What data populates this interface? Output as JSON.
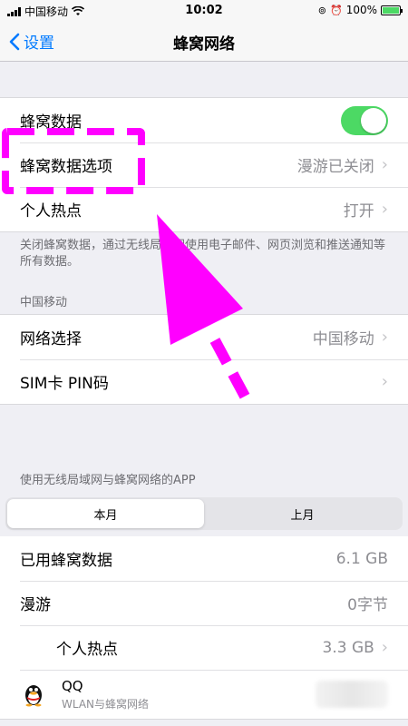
{
  "status_bar": {
    "carrier": "中国移动",
    "time": "10:02",
    "battery_percent": "100%",
    "battery_level": 1.0
  },
  "nav": {
    "back_label": "设置",
    "title": "蜂窝网络"
  },
  "cellular_group": {
    "cellular_data": {
      "label": "蜂窝数据",
      "enabled": true
    },
    "cellular_data_options": {
      "label": "蜂窝数据选项",
      "value": "漫游已关闭"
    },
    "personal_hotspot": {
      "label": "个人热点",
      "value": "打开"
    }
  },
  "cellular_footnote": "关闭蜂窝数据，通过无线局域网使用电子邮件、网页浏览和推送通知等所有数据。",
  "carrier_header": "中国移动",
  "carrier_group": {
    "network_selection": {
      "label": "网络选择",
      "value": "中国移动"
    },
    "sim_pin": {
      "label": "SIM卡 PIN码"
    }
  },
  "apps_header": "使用无线局域网与蜂窝网络的APP",
  "segment": {
    "this_month": "本月",
    "last_month": "上月"
  },
  "usage": {
    "used": {
      "label": "已用蜂窝数据",
      "value": "6.1 GB"
    },
    "roaming": {
      "label": "漫游",
      "value": "0字节"
    },
    "hotspot": {
      "label": "个人热点",
      "value": "3.3 GB"
    }
  },
  "apps": [
    {
      "name": "QQ",
      "sub": "WLAN与蜂窝网络",
      "icon": "qq-penguin-icon"
    }
  ],
  "colors": {
    "accent": "#007aff",
    "toggle_on": "#4cd964",
    "annotation": "#ff00ff"
  }
}
